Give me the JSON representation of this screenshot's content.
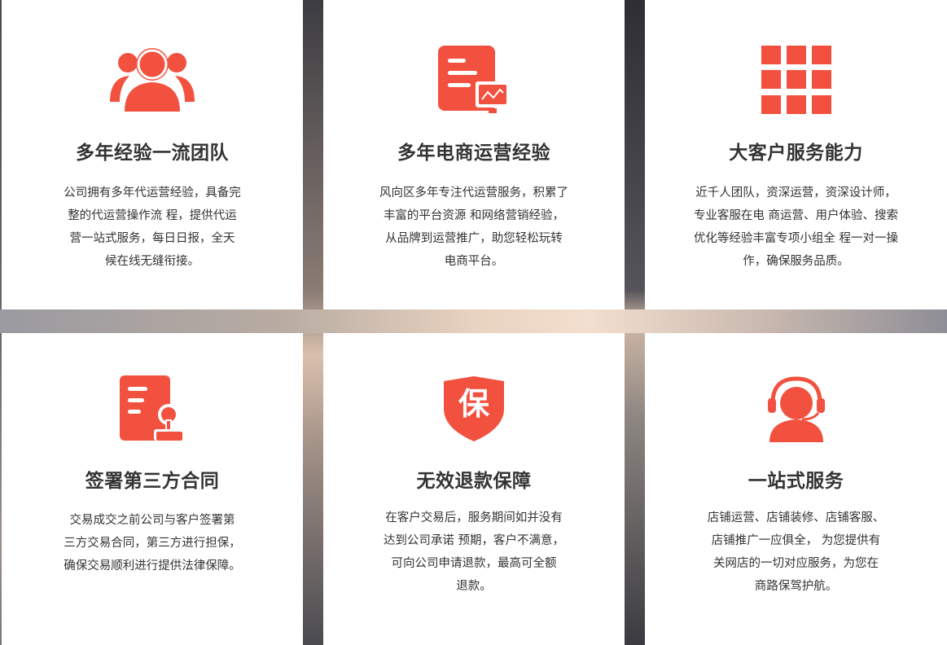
{
  "colors": {
    "accent": "#f2513f",
    "card_bg": "#ffffff",
    "text": "#333333"
  },
  "features": [
    {
      "icon": "team-icon",
      "title": "多年经验一流团队",
      "lines": [
        "公司拥有多年代运营经验，具备完",
        "整的代运营操作流 程，提供代运",
        "营一站式服务，每日日报，全天",
        "候在线无缝衔接。"
      ]
    },
    {
      "icon": "report-icon",
      "title": "多年电商运营经验",
      "lines": [
        "风向区多年专注代运营服务，积累了",
        "丰富的平台资源 和网络营销经验，",
        "从品牌到运营推广，助您轻松玩转",
        "电商平台。"
      ]
    },
    {
      "icon": "grid-icon",
      "title": "大客户服务能力",
      "lines": [
        "近千人团队，资深运营，资深设计师，",
        "专业客服在电 商运营、用户体验、搜索",
        "优化等经验丰富专项小组全 程一对一操",
        "作，确保服务品质。"
      ]
    },
    {
      "icon": "contract-icon",
      "title": "签署第三方合同",
      "lines": [
        "交易成交之前公司与客户签署第",
        "三方交易合同，第三方进行担保，",
        "确保交易顺利进行提供法律保障。"
      ]
    },
    {
      "icon": "shield-icon",
      "icon_text": "保",
      "title": "无效退款保障",
      "lines": [
        "在客户交易后，服务期间如并没有",
        "达到公司承诺 预期，客户不满意，",
        "可向公司申请退款，最高可全额",
        "退款。"
      ]
    },
    {
      "icon": "headset-icon",
      "title": "一站式服务",
      "lines": [
        "店铺运营、店铺装修、店铺客服、",
        "店铺推广一应俱全， 为您提供有",
        "关网店的一切对应服务，为您在",
        "商路保驾护航。"
      ]
    }
  ]
}
